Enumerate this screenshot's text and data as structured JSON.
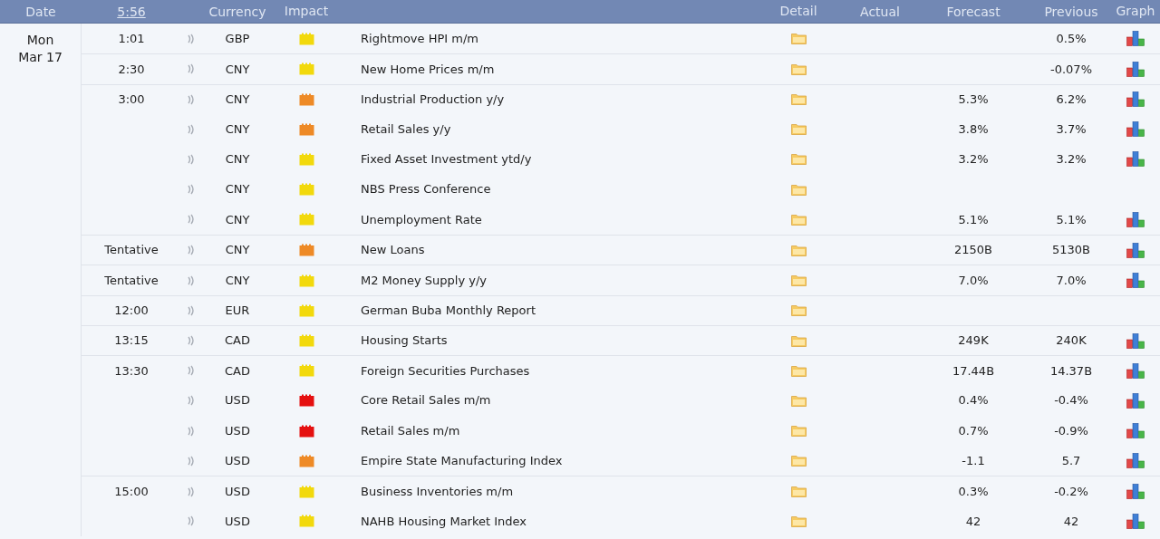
{
  "header": {
    "date": "Date",
    "time": "5:56",
    "currency": "Currency",
    "impact": "Impact",
    "detail": "Detail",
    "actual": "Actual",
    "forecast": "Forecast",
    "previous": "Previous",
    "graph": "Graph"
  },
  "day": {
    "weekday": "Mon",
    "date": "Mar 17"
  },
  "events": [
    {
      "time": "1:01",
      "currency": "GBP",
      "color": "#f2d90c",
      "title": "Rightmove HPI m/m",
      "previous": "0.5%",
      "graph": true
    },
    {
      "time": "2:30",
      "currency": "CNY",
      "color": "#f2d90c",
      "title": "New Home Prices m/m",
      "previous": "-0.07%",
      "graph": true
    },
    {
      "time": "3:00",
      "currency": "CNY",
      "color": "#ee8a26",
      "title": "Industrial Production y/y",
      "forecast": "5.3%",
      "previous": "6.2%",
      "graph": true
    },
    {
      "currency": "CNY",
      "color": "#ee8a26",
      "title": "Retail Sales y/y",
      "forecast": "3.8%",
      "previous": "3.7%",
      "graph": true
    },
    {
      "currency": "CNY",
      "color": "#f2d90c",
      "title": "Fixed Asset Investment ytd/y",
      "forecast": "3.2%",
      "previous": "3.2%",
      "graph": true
    },
    {
      "currency": "CNY",
      "color": "#f2d90c",
      "title": "NBS Press Conference",
      "graph": false
    },
    {
      "currency": "CNY",
      "color": "#f2d90c",
      "title": "Unemployment Rate",
      "forecast": "5.1%",
      "previous": "5.1%",
      "graph": true
    },
    {
      "time": "Tentative",
      "currency": "CNY",
      "color": "#ee8a26",
      "title": "New Loans",
      "forecast": "2150B",
      "previous": "5130B",
      "graph": true
    },
    {
      "time": "Tentative",
      "currency": "CNY",
      "color": "#f2d90c",
      "title": "M2 Money Supply y/y",
      "forecast": "7.0%",
      "previous": "7.0%",
      "graph": true
    },
    {
      "time": "12:00",
      "currency": "EUR",
      "color": "#f2d90c",
      "title": "German Buba Monthly Report",
      "graph": false
    },
    {
      "time": "13:15",
      "currency": "CAD",
      "color": "#f2d90c",
      "title": "Housing Starts",
      "forecast": "249K",
      "previous": "240K",
      "graph": true
    },
    {
      "time": "13:30",
      "currency": "CAD",
      "color": "#f2d90c",
      "title": "Foreign Securities Purchases",
      "forecast": "17.44B",
      "previous": "14.37B",
      "graph": true
    },
    {
      "currency": "USD",
      "color": "#e51010",
      "title": "Core Retail Sales m/m",
      "forecast": "0.4%",
      "previous": "-0.4%",
      "graph": true
    },
    {
      "currency": "USD",
      "color": "#e51010",
      "title": "Retail Sales m/m",
      "forecast": "0.7%",
      "previous": "-0.9%",
      "graph": true
    },
    {
      "currency": "USD",
      "color": "#ee8a26",
      "title": "Empire State Manufacturing Index",
      "forecast": "-1.1",
      "previous": "5.7",
      "graph": true
    },
    {
      "time": "15:00",
      "currency": "USD",
      "color": "#f2d90c",
      "title": "Business Inventories m/m",
      "forecast": "0.3%",
      "previous": "-0.2%",
      "graph": true
    },
    {
      "currency": "USD",
      "color": "#f2d90c",
      "title": "NAHB Housing Market Index",
      "forecast": "42",
      "previous": "42",
      "graph": true
    }
  ]
}
